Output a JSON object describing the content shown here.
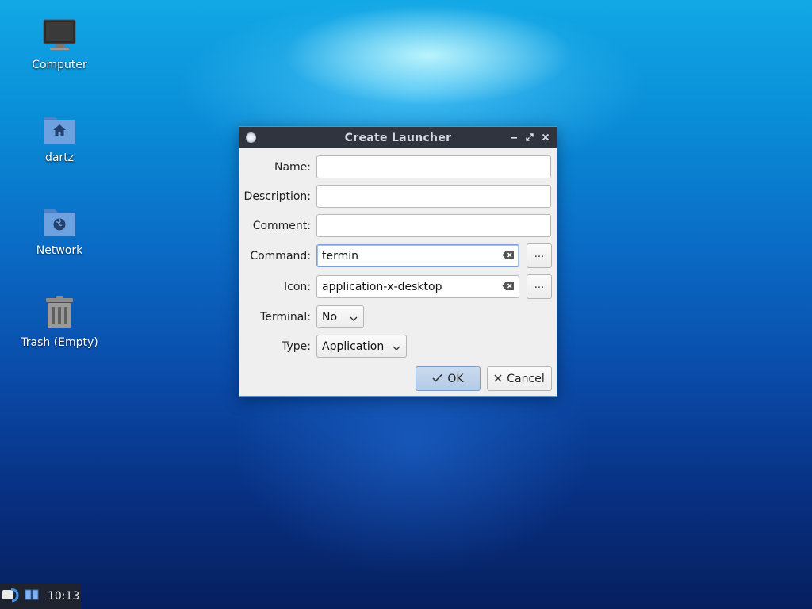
{
  "desktop": {
    "icons": [
      {
        "label": "Computer",
        "icon": "computer-icon"
      },
      {
        "label": "dartz",
        "icon": "home-folder-icon"
      },
      {
        "label": "Network",
        "icon": "network-folder-icon"
      },
      {
        "label": "Trash (Empty)",
        "icon": "trash-icon"
      }
    ]
  },
  "dialog": {
    "title": "Create Launcher",
    "fields": {
      "name": {
        "label": "Name:",
        "value": ""
      },
      "description": {
        "label": "Description:",
        "value": ""
      },
      "comment": {
        "label": "Comment:",
        "value": ""
      },
      "command": {
        "label": "Command:",
        "value": "termin"
      },
      "icon": {
        "label": "Icon:",
        "value": "application-x-desktop"
      },
      "terminal": {
        "label": "Terminal:",
        "selected": "No"
      },
      "type": {
        "label": "Type:",
        "selected": "Application"
      }
    },
    "browse_label": "...",
    "ok_label": "OK",
    "cancel_label": "Cancel"
  },
  "taskbar": {
    "clock": "10:13"
  },
  "colors": {
    "titlebar_bg": "#2f343f",
    "dialog_bg": "#efefef",
    "ok_button_bg": "#c0d4ea",
    "taskbar_bg": "#1f2330"
  }
}
